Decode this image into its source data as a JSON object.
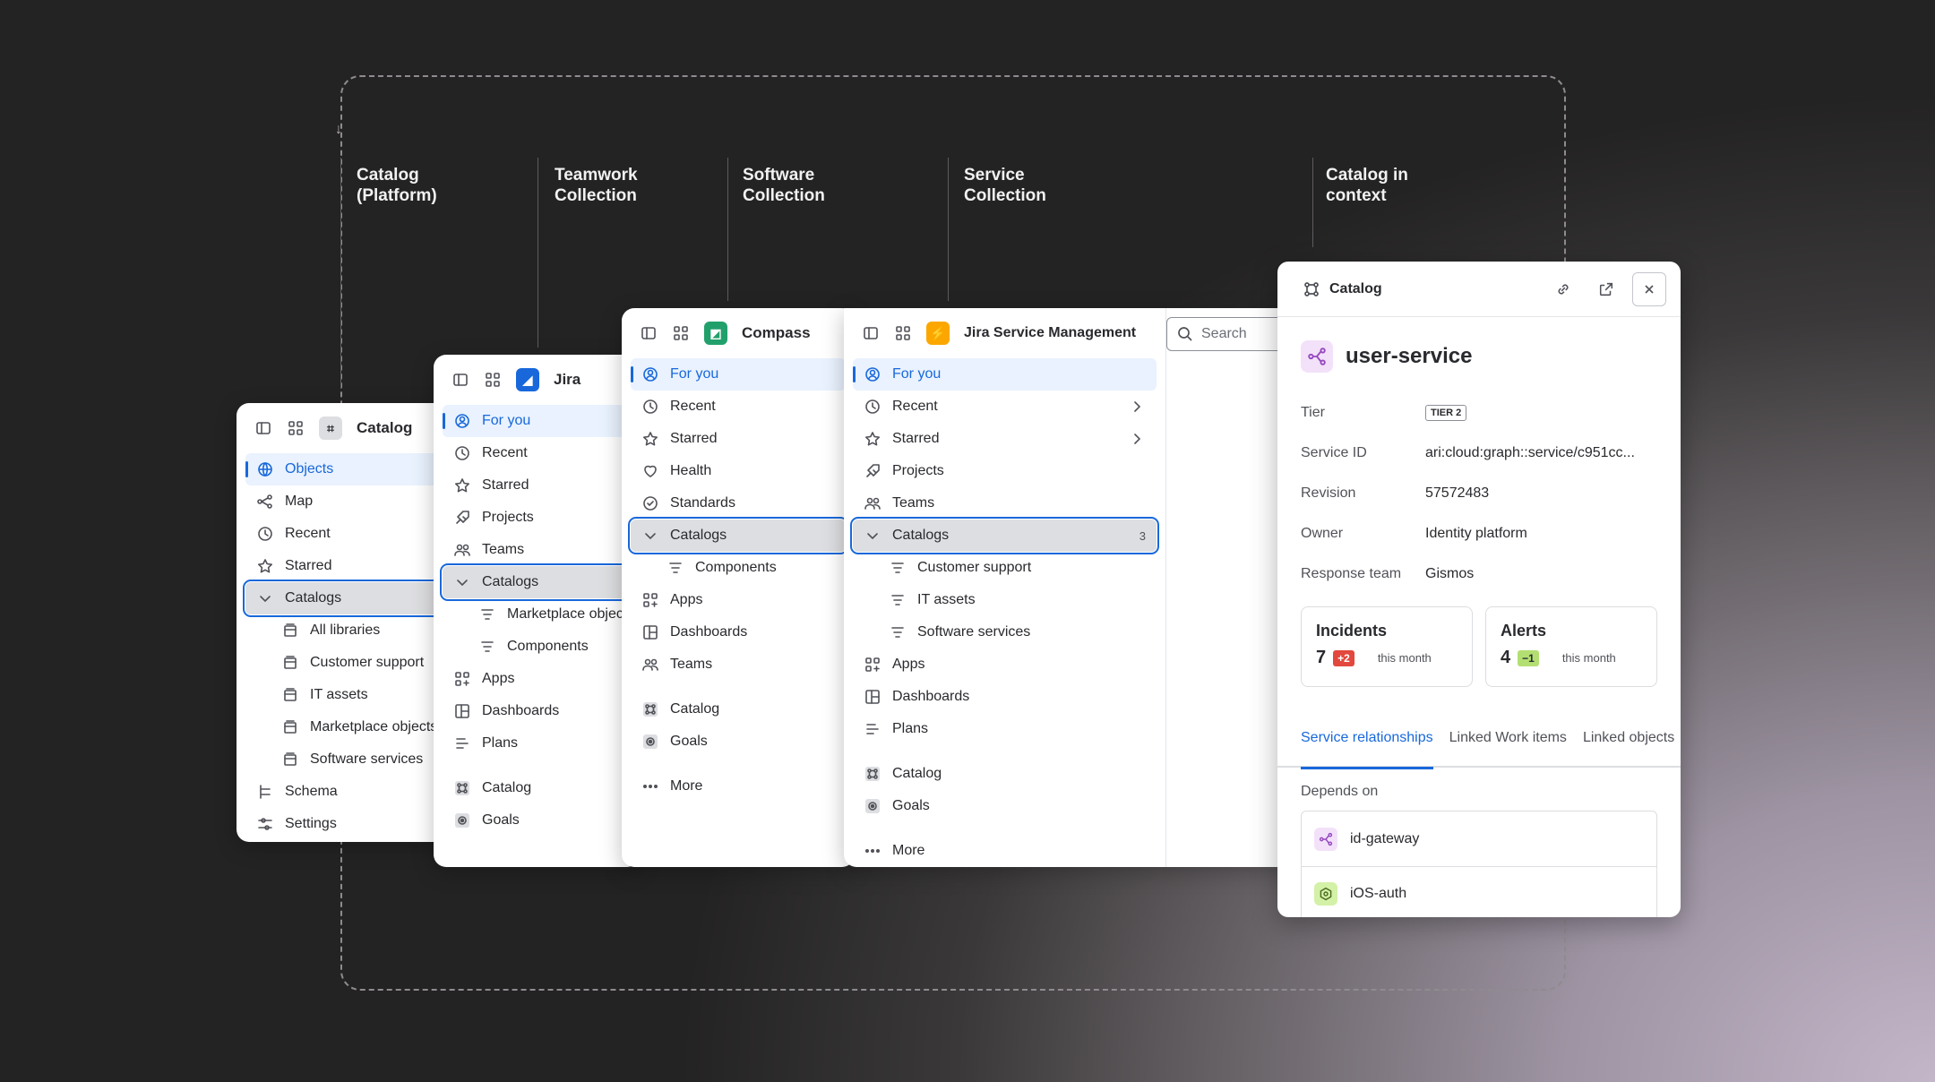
{
  "columns": [
    "Catalog\n(Platform)",
    "Teamwork\nCollection",
    "Software\nCollection",
    "Service\nCollection",
    "Catalog in\ncontext"
  ],
  "catalog_panel": {
    "app": "Catalog",
    "items": [
      {
        "label": "Objects",
        "icon": "globe-icon",
        "state": "active"
      },
      {
        "label": "Map",
        "icon": "map-icon"
      },
      {
        "label": "Recent",
        "icon": "clock-icon"
      },
      {
        "label": "Starred",
        "icon": "star-icon"
      },
      {
        "label": "Catalogs",
        "icon": "chevron-down-icon",
        "state": "selected"
      },
      {
        "label": "All libraries",
        "icon": "library-icon",
        "sub": true
      },
      {
        "label": "Customer support",
        "icon": "library-icon",
        "sub": true
      },
      {
        "label": "IT assets",
        "icon": "library-icon",
        "sub": true
      },
      {
        "label": "Marketplace objects",
        "icon": "library-icon",
        "sub": true
      },
      {
        "label": "Software services",
        "icon": "library-icon",
        "sub": true
      },
      {
        "label": "Schema",
        "icon": "schema-icon"
      },
      {
        "label": "Settings",
        "icon": "settings-icon"
      }
    ]
  },
  "jira_panel": {
    "app": "Jira",
    "items": [
      {
        "label": "For you",
        "icon": "user-circle-icon",
        "state": "active"
      },
      {
        "label": "Recent",
        "icon": "clock-icon"
      },
      {
        "label": "Starred",
        "icon": "star-icon"
      },
      {
        "label": "Projects",
        "icon": "rocket-icon"
      },
      {
        "label": "Teams",
        "icon": "people-icon"
      },
      {
        "label": "Catalogs",
        "icon": "chevron-down-icon",
        "state": "selected"
      },
      {
        "label": "Marketplace objects",
        "icon": "filter-icon",
        "sub": true
      },
      {
        "label": "Components",
        "icon": "filter-icon",
        "sub": true
      },
      {
        "label": "Apps",
        "icon": "apps-icon"
      },
      {
        "label": "Dashboards",
        "icon": "dashboard-icon"
      },
      {
        "label": "Plans",
        "icon": "plans-icon"
      },
      {
        "gap": true
      },
      {
        "label": "Catalog",
        "icon": "catalog-icon"
      },
      {
        "label": "Goals",
        "icon": "goal-icon"
      }
    ]
  },
  "compass_panel": {
    "app": "Compass",
    "items": [
      {
        "label": "For you",
        "icon": "user-circle-icon",
        "state": "active"
      },
      {
        "label": "Recent",
        "icon": "clock-icon"
      },
      {
        "label": "Starred",
        "icon": "star-icon"
      },
      {
        "label": "Health",
        "icon": "heart-icon"
      },
      {
        "label": "Standards",
        "icon": "check-circle-icon"
      },
      {
        "label": "Catalogs",
        "icon": "chevron-down-icon",
        "state": "selected"
      },
      {
        "label": "Components",
        "icon": "filter-icon",
        "sub": true
      },
      {
        "label": "Apps",
        "icon": "apps-icon"
      },
      {
        "label": "Dashboards",
        "icon": "dashboard-icon"
      },
      {
        "label": "Teams",
        "icon": "people-icon"
      },
      {
        "gap": true
      },
      {
        "label": "Catalog",
        "icon": "catalog-icon"
      },
      {
        "label": "Goals",
        "icon": "goal-icon"
      },
      {
        "gap": true
      },
      {
        "label": "More",
        "icon": "more-icon"
      }
    ]
  },
  "jsm_panel": {
    "app": "Jira Service Management",
    "search_placeholder": "Search",
    "items": [
      {
        "label": "For you",
        "icon": "user-circle-icon",
        "state": "active"
      },
      {
        "label": "Recent",
        "icon": "clock-icon",
        "chevron": true
      },
      {
        "label": "Starred",
        "icon": "star-icon",
        "chevron": true
      },
      {
        "label": "Projects",
        "icon": "rocket-icon"
      },
      {
        "label": "Teams",
        "icon": "people-icon"
      },
      {
        "label": "Catalogs",
        "icon": "chevron-down-icon",
        "state": "selected",
        "count": "3"
      },
      {
        "label": "Customer support",
        "icon": "filter-icon",
        "sub": true
      },
      {
        "label": "IT assets",
        "icon": "filter-icon",
        "sub": true
      },
      {
        "label": "Software services",
        "icon": "filter-icon",
        "sub": true
      },
      {
        "label": "Apps",
        "icon": "apps-icon"
      },
      {
        "label": "Dashboards",
        "icon": "dashboard-icon"
      },
      {
        "label": "Plans",
        "icon": "plans-icon"
      },
      {
        "gap": true
      },
      {
        "label": "Catalog",
        "icon": "catalog-icon"
      },
      {
        "label": "Goals",
        "icon": "goal-icon"
      },
      {
        "gap": true
      },
      {
        "label": "More",
        "icon": "more-icon"
      }
    ]
  },
  "side_panel": {
    "title": "Catalog",
    "service": "user-service",
    "fields": [
      {
        "k": "Tier",
        "v": "TIER 2",
        "tag": true
      },
      {
        "k": "Service ID",
        "v": "ari:cloud:graph::service/c951cc..."
      },
      {
        "k": "Revision",
        "v": "57572483"
      },
      {
        "k": "Owner",
        "v": "Identity platform"
      },
      {
        "k": "Response team",
        "v": "Gismos"
      }
    ],
    "incidents": {
      "title": "Incidents",
      "value": "7",
      "delta": "+2",
      "period": "this month"
    },
    "alerts": {
      "title": "Alerts",
      "value": "4",
      "delta": "−1",
      "period": "this month"
    },
    "tabs": [
      "Service relationships",
      "Linked Work items",
      "Linked objects"
    ],
    "depends_label": "Depends on",
    "depends": [
      {
        "name": "id-gateway",
        "icon": "service-icon",
        "color": "#f3e1fa"
      },
      {
        "name": "iOS-auth",
        "icon": "component-icon",
        "color": "#d3f1a7"
      }
    ]
  },
  "colors": {
    "accent": "#1868db",
    "jira": "#1868db",
    "compass": "#22a06b",
    "jsm": "#fca700"
  }
}
